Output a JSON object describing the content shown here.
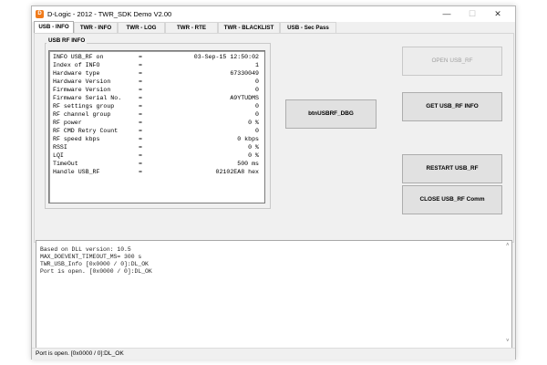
{
  "window": {
    "title": "D-Logic - 2012  - TWR_SDK Demo V2.00",
    "app_icon": "D",
    "min_glyph": "—",
    "max_glyph": "☐",
    "close_glyph": "✕"
  },
  "tabs": [
    {
      "label": "USB - INFO",
      "active": true
    },
    {
      "label": "TWR - INFO"
    },
    {
      "label": "TWR - LOG"
    },
    {
      "label": "TWR - RTE"
    },
    {
      "label": "TWR - BLACKLIST"
    },
    {
      "label": "USB - Sec Pass"
    }
  ],
  "usb_rf_info": {
    "group_label": "USB RF INFO",
    "rows": [
      {
        "key": "INFO USB_RF on",
        "eq": "=",
        "value": "03-Sep-15 12:50:02"
      },
      {
        "key": "Index of INFO",
        "eq": "=",
        "value": "1"
      },
      {
        "key": "Hardware type",
        "eq": "=",
        "value": "67330049"
      },
      {
        "key": "Hardware Version",
        "eq": "=",
        "value": "0"
      },
      {
        "key": "Firmware Version",
        "eq": "=",
        "value": "0"
      },
      {
        "key": "Firmware Serial No.",
        "eq": "=",
        "value": "A9YTUDMS"
      },
      {
        "key": "RF settings group",
        "eq": "=",
        "value": "0"
      },
      {
        "key": "RF channel group",
        "eq": "=",
        "value": "0"
      },
      {
        "key": "RF power",
        "eq": "=",
        "value": "0 %"
      },
      {
        "key": "RF CMD Retry Count",
        "eq": "=",
        "value": "0"
      },
      {
        "key": "RF speed kbps",
        "eq": "=",
        "value": "0 kbps"
      },
      {
        "key": "RSSI",
        "eq": "=",
        "value": "0 %"
      },
      {
        "key": "LQI",
        "eq": "=",
        "value": "0 %"
      },
      {
        "key": "TimeOut",
        "eq": "=",
        "value": "500 ms"
      },
      {
        "key": "Handle USB_RF",
        "eq": "=",
        "value": "02102EA8 hex"
      }
    ]
  },
  "buttons": {
    "dbg": "btnUSBRF_DBG",
    "open": "OPEN USB_RF",
    "get_info": "GET USB_RF INFO",
    "restart": "RESTART USB_RF",
    "close_comm": "CLOSE USB_RF Comm"
  },
  "log": {
    "lines": [
      "Based on DLL version: 10.5",
      "MAX_DOEVENT_TIMEOUT_MS= 300 s",
      "TWR_USB_Info [0x0000 / 0]:DL_OK",
      "Port is open. [0x0000 / 0]:DL_OK"
    ],
    "scroll_up_glyph": "˄",
    "scroll_down_glyph": "˅"
  },
  "status": {
    "text": "Port is open. [0x0000 / 0]:DL_OK"
  }
}
